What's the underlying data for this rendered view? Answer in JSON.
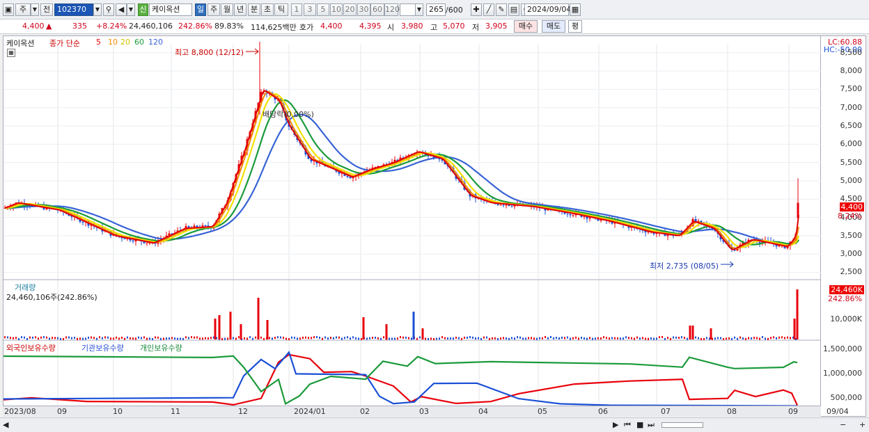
{
  "toolbar": {
    "market": "주",
    "prev": "전",
    "code": "102370",
    "name": "케이옥션",
    "shin": "신",
    "periods": [
      "일",
      "주",
      "월",
      "년",
      "분",
      "초",
      "틱"
    ],
    "nums": [
      "1",
      "3",
      "5",
      "10",
      "20",
      "30",
      "60",
      "120"
    ],
    "count": "265",
    "countMax": "/600",
    "date": "2024/09/04"
  },
  "quote": {
    "price": "4,400",
    "arrow": "▲",
    "change": "335",
    "rate": "+8.24%",
    "volume": "24,460,106",
    "volRate": "242.86%",
    "turnover": "89.83%",
    "amount": "114,625백만",
    "hoga": "호가",
    "ask": "4,400",
    "bid": "4,395",
    "openL": "시",
    "open": "3,980",
    "highL": "고",
    "high": "5,070",
    "lowL": "저",
    "low": "3,905",
    "buy": "매수",
    "sell": "매도",
    "eval": "평"
  },
  "price_panel": {
    "title": "케이옥션",
    "ma_label": "종가 단순",
    "ma": [
      "5",
      "10",
      "20",
      "60",
      "120"
    ],
    "high_note": "최고 8,800 (12/12)",
    "low_note": "최저 2,735 (08/05)",
    "div_note": "배당락(0.00%)",
    "lc": "LC:60.88",
    "hc": "HC:-50.00",
    "last": "4,400",
    "last_rate": "8.24%",
    "yticks": [
      "8,500",
      "8,000",
      "7,500",
      "7,000",
      "6,500",
      "6,000",
      "5,500",
      "5,000",
      "4,500",
      "4,000",
      "3,500",
      "3,000",
      "2,500"
    ]
  },
  "volume_panel": {
    "title": "거래량",
    "value": "24,460,106주(242.86%)",
    "tag": "24,460K",
    "tag_rate": "242.86%",
    "ytick": "10,000K"
  },
  "holdings_panel": {
    "s1": "외국인보유수량",
    "s2": "기관보유수량",
    "s3": "개인보유수량",
    "yticks": [
      "1,500,000",
      "1,000,000",
      "500,000"
    ]
  },
  "xaxis": [
    "2023/08",
    "09",
    "10",
    "11",
    "12",
    "2024/01",
    "02",
    "03",
    "04",
    "05",
    "06",
    "07",
    "08",
    "09",
    "09/04"
  ],
  "colors": {
    "up": "#e8000b",
    "down": "#1a4fd6",
    "ma5": "#e00000",
    "ma10": "#f08a00",
    "ma20": "#f2e200",
    "ma60": "#1a9a3a",
    "ma120": "#3763d6"
  },
  "chart_data": [
    {
      "type": "candlestick",
      "ylim": [
        2500,
        8800
      ],
      "ma": [
        "5",
        "10",
        "20",
        "60",
        "120"
      ],
      "x": [
        "2023/08",
        "09",
        "10",
        "11",
        "12",
        "2024/01",
        "02",
        "03",
        "04",
        "05",
        "06",
        "07",
        "08",
        "09"
      ],
      "close": [
        4300,
        4200,
        3500,
        3700,
        7400,
        5300,
        5500,
        5600,
        4300,
        4200,
        3700,
        3500,
        3300,
        4400
      ],
      "high_point": {
        "date": "12/12",
        "value": 8800
      },
      "low_point": {
        "date": "08/05",
        "value": 2735
      }
    },
    {
      "type": "bar",
      "name": "거래량",
      "last": 24460106
    },
    {
      "type": "line",
      "series": [
        {
          "name": "외국인보유수량"
        },
        {
          "name": "기관보유수량"
        },
        {
          "name": "개인보유수량"
        }
      ],
      "ylim": [
        400000,
        1550000
      ]
    }
  ]
}
